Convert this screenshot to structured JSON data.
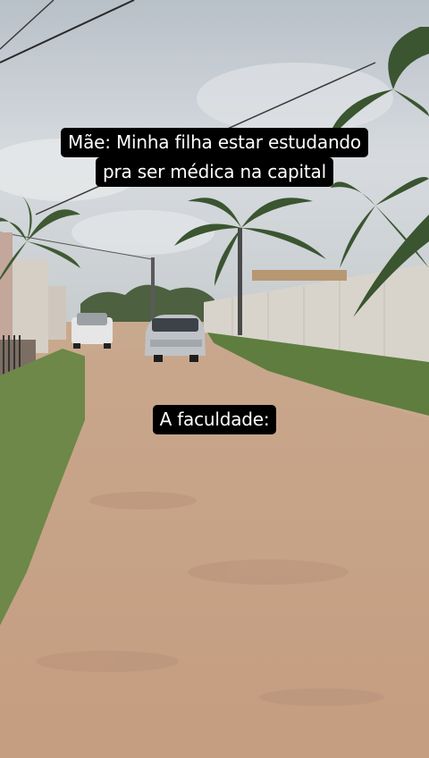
{
  "overlay": {
    "caption_top": {
      "line1": "Mãe: Minha filha estar estudando",
      "line2": "pra ser médica na capital"
    },
    "caption_mid": "A faculdade:"
  },
  "scene": {
    "description_colors": {
      "sky": "#c9d0d6",
      "dirt_road": "#c4a088",
      "grass": "#6f8a4a",
      "wall": "#d9d5cd",
      "palm": "#3d5632"
    }
  }
}
